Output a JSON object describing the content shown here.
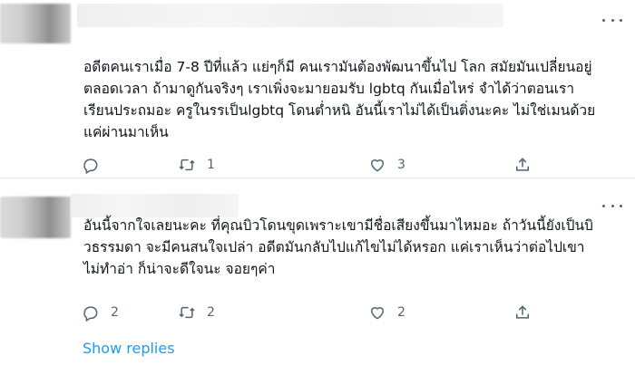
{
  "tweets": [
    {
      "text": "อดีตคนเราเมื่อ 7-8 ปีที่แล้ว แย่ๆก็มี คนเรามันต้องพัฒนาขึ้นไป โลก สมัยมันเปลี่ยนอยู่\nตลอดเวลา ถ้ามาดูกันจริงๆ เราเพิ่งจะมายอมรับ lgbtq กันเมื่อไหร่ จำได้ว่าตอนเรา\nเรียนประถมอะ ครูในรรเป็นlgbtq โดนต่ำหนิ อันนี้เราไม่ได้เป็นติ่งนะคะ ไม่ใช่เมนด้วย\nแค่ผ่านมาเห็น",
      "reply_count": "",
      "retweet_count": "1",
      "like_count": "3"
    },
    {
      "text": "อันนี้จากใจเลยนะคะ ที่คุณบิวโดนขุดเพราะเขามีชื่อเสียงขึ้นมาไหมอะ ถ้าวันนี้ยังเป็นบิ\nวธรรมดา จะมีคนสนใจเปล่า อดีตมันกลับไปแก้ไขไม่ได้หรอก แค่เราเห็นว่าต่อไปเขา\nไม่ทำอ่า ก็น่าจะดีใจนะ จอยๆค่า",
      "reply_count": "2",
      "retweet_count": "2",
      "like_count": "2"
    }
  ],
  "show_replies_label": "Show replies",
  "icons": {
    "more": "more-horizontal-icon",
    "reply": "reply-bubble-icon",
    "retweet": "retweet-icon",
    "like": "heart-icon",
    "share": "share-icon"
  },
  "colors": {
    "link": "#1d9bf0",
    "icon": "#536471",
    "divider": "#e1e8ed"
  }
}
